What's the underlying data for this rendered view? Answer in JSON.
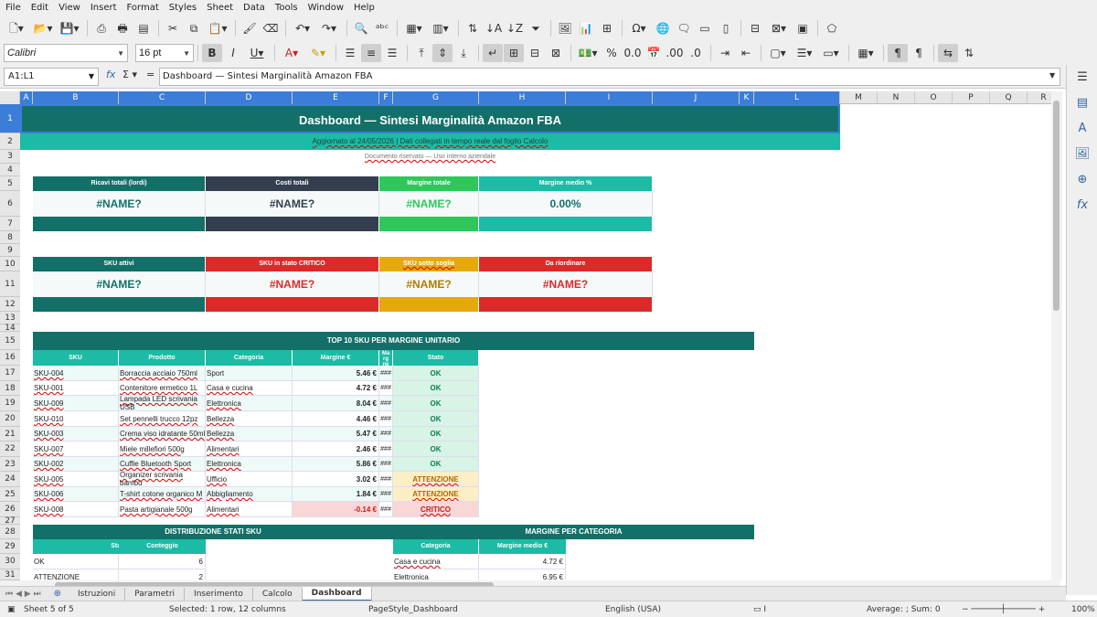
{
  "menu": [
    "File",
    "Edit",
    "View",
    "Insert",
    "Format",
    "Styles",
    "Sheet",
    "Data",
    "Tools",
    "Window",
    "Help"
  ],
  "toolbar": {
    "font_name": "Calibri",
    "font_size": "16 pt"
  },
  "formula_bar": {
    "name_box": "A1:L1",
    "content": "Dashboard — Sintesi Marginalità Amazon FBA"
  },
  "columns": [
    "A",
    "B",
    "C",
    "D",
    "E",
    "F",
    "G",
    "H",
    "I",
    "J",
    "K",
    "L",
    "M",
    "N",
    "O",
    "P",
    "Q",
    "R"
  ],
  "rows": [
    "1",
    "2",
    "3",
    "4",
    "5",
    "6",
    "7",
    "8",
    "9",
    "10",
    "11",
    "12",
    "13",
    "14",
    "15",
    "16",
    "17",
    "18",
    "19",
    "20",
    "21",
    "22",
    "23",
    "24",
    "25",
    "26",
    "27",
    "28",
    "29",
    "30",
    "31"
  ],
  "sheet": {
    "title": "Dashboard — Sintesi Marginalità Amazon FBA",
    "subtitle": "Aggiornato al 24/05/2026  |  Dati collegati in tempo reale dal foglio Calcolo",
    "note": "Documento riservato — Uso interno aziendale",
    "kpi1": {
      "labels": [
        "Ricavi totali (lordi)",
        "Costi totali",
        "Margine totale",
        "Margine medio %"
      ],
      "values": [
        "#NAME?",
        "#NAME?",
        "#NAME?",
        "0.00%"
      ]
    },
    "kpi2": {
      "labels": [
        "SKU attivi",
        "SKU in stato CRITICO",
        "SKU sotto soglia",
        "Da riordinare"
      ],
      "values": [
        "#NAME?",
        "#NAME?",
        "#NAME?",
        "#NAME?"
      ]
    },
    "top10": {
      "title": "TOP 10 SKU PER MARGINE UNITARIO",
      "headers": [
        "SKU",
        "Prodotto",
        "Categoria",
        "Margine €",
        "Ma rg ne",
        "Stato"
      ],
      "rows": [
        {
          "sku": "SKU-004",
          "prodotto": "Borraccia acciaio 750ml",
          "categoria": "Sport",
          "margine": "5.46 €",
          "pct": "###",
          "stato": "OK"
        },
        {
          "sku": "SKU-001",
          "prodotto": "Contenitore ermetico 1L",
          "categoria": "Casa e cucina",
          "margine": "4.72 €",
          "pct": "###",
          "stato": "OK"
        },
        {
          "sku": "SKU-009",
          "prodotto": "Lampada LED scrivania USB",
          "categoria": "Elettronica",
          "margine": "8.04 €",
          "pct": "###",
          "stato": "OK"
        },
        {
          "sku": "SKU-010",
          "prodotto": "Set pennelli trucco 12pz",
          "categoria": "Bellezza",
          "margine": "4.46 €",
          "pct": "###",
          "stato": "OK"
        },
        {
          "sku": "SKU-003",
          "prodotto": "Crema viso idratante 50ml",
          "categoria": "Bellezza",
          "margine": "5.47 €",
          "pct": "###",
          "stato": "OK"
        },
        {
          "sku": "SKU-007",
          "prodotto": "Miele millefiori 500g",
          "categoria": "Alimentari",
          "margine": "2.46 €",
          "pct": "###",
          "stato": "OK"
        },
        {
          "sku": "SKU-002",
          "prodotto": "Cuffie Bluetooth Sport",
          "categoria": "Elettronica",
          "margine": "5.86 €",
          "pct": "###",
          "stato": "OK"
        },
        {
          "sku": "SKU-005",
          "prodotto": "Organizer scrivania bambù",
          "categoria": "Ufficio",
          "margine": "3.02 €",
          "pct": "###",
          "stato": "ATTENZIONE"
        },
        {
          "sku": "SKU-006",
          "prodotto": "T-shirt cotone organico M",
          "categoria": "Abbigliamento",
          "margine": "1.84 €",
          "pct": "###",
          "stato": "ATTENZIONE"
        },
        {
          "sku": "SKU-008",
          "prodotto": "Pasta artigianale 500g",
          "categoria": "Alimentari",
          "margine": "-0.14 €",
          "pct": "###",
          "stato": "CRITICO"
        }
      ]
    },
    "distribuzione": {
      "title": "DISTRIBUZIONE STATI SKU",
      "headers": [
        "Stato",
        "Conteggio"
      ],
      "rows": [
        {
          "stato": "OK",
          "count": "6"
        },
        {
          "stato": "ATTENZIONE",
          "count": "2"
        }
      ]
    },
    "categoria": {
      "title": "MARGINE PER CATEGORIA",
      "headers": [
        "Categoria",
        "Margine medio €"
      ],
      "rows": [
        {
          "cat": "Casa e cucina",
          "val": "4.72 €"
        },
        {
          "cat": "Elettronica",
          "val": "6.95 €"
        }
      ]
    }
  },
  "sheet_tabs": [
    "Istruzioni",
    "Parametri",
    "Inserimento",
    "Calcolo",
    "Dashboard"
  ],
  "status": {
    "sheet": "Sheet 5 of 5",
    "selection": "Selected: 1 row, 12 columns",
    "page_style": "PageStyle_Dashboard",
    "language": "English (USA)",
    "summary": "Average: ; Sum: 0",
    "zoom": "100%"
  },
  "colors": {
    "teal_dark": "#127068",
    "teal_light": "#1bbba5",
    "slate": "#333f4f",
    "green": "#2ec85a",
    "red": "#db2a2a",
    "amber": "#e6a90d",
    "ok_bg": "#d7f4e6",
    "warn_bg": "#fdefc5",
    "crit_bg": "#f9d7d7"
  }
}
